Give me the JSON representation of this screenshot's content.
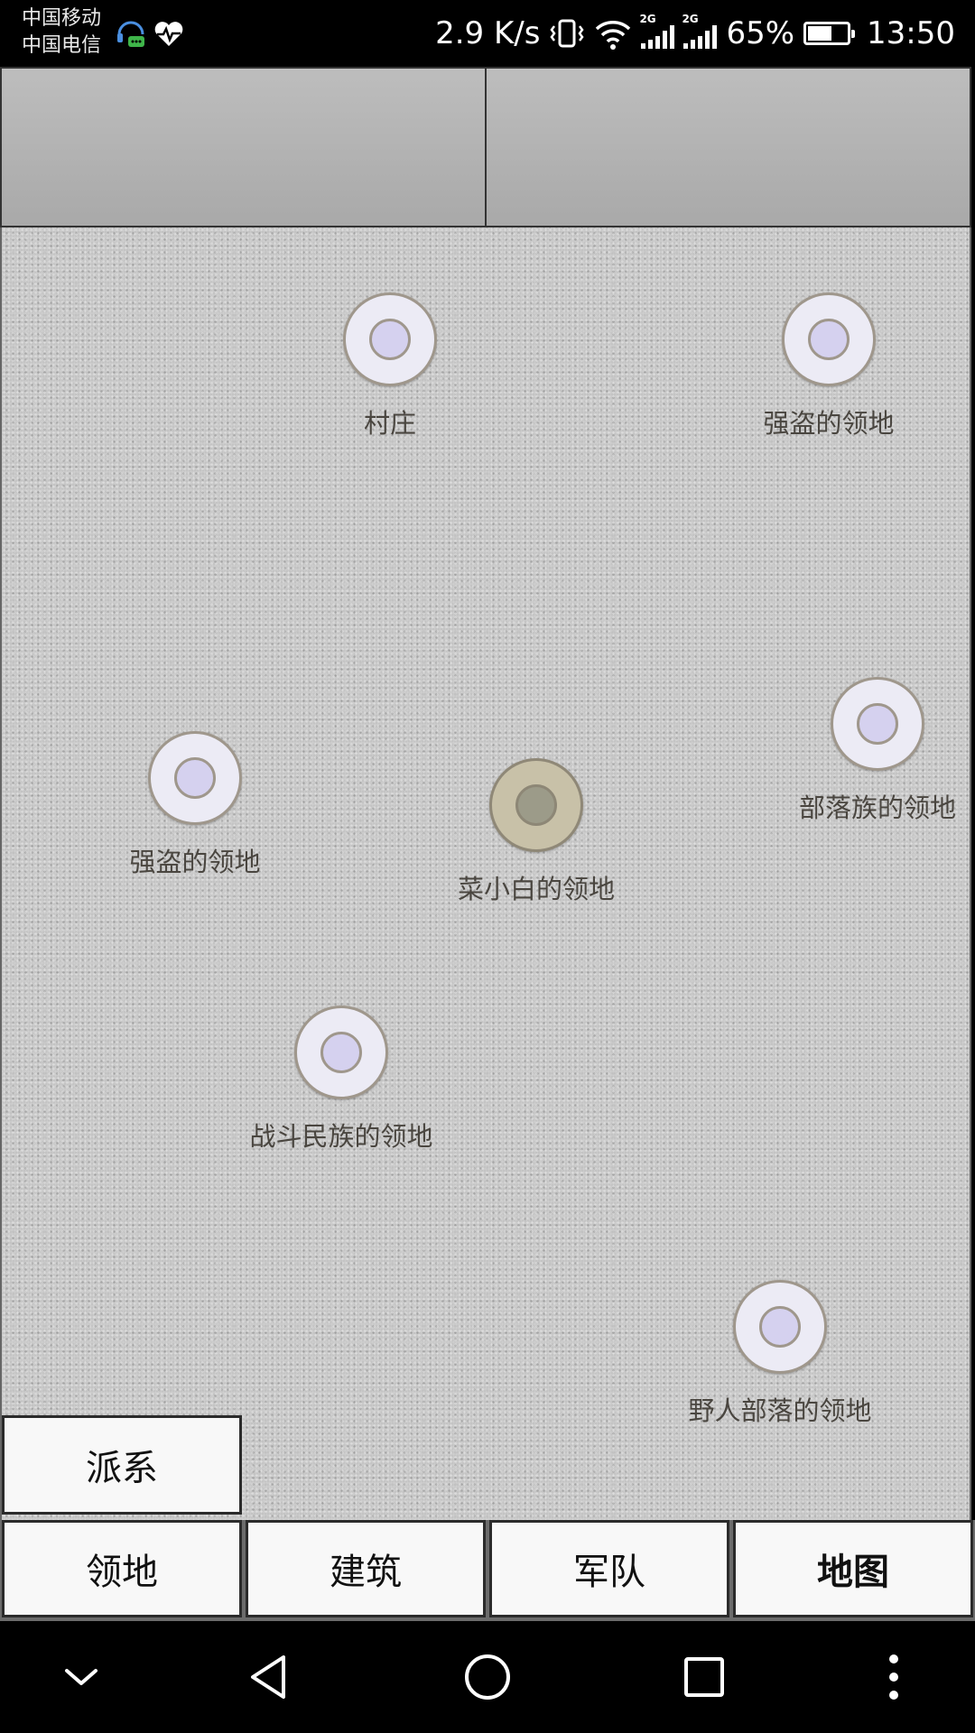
{
  "status_bar": {
    "carrier_1": "中国移动",
    "carrier_2": "中国电信",
    "net_speed": "2.9 K/s",
    "signal_1_tag": "2G",
    "signal_2_tag": "2G",
    "battery_percent": "65%",
    "battery_level": 0.65,
    "time": "13:50",
    "icons": [
      "headset-chat-icon",
      "heart-rate-icon",
      "vibrate-icon",
      "wifi-icon",
      "signal-icon",
      "battery-icon"
    ]
  },
  "map": {
    "nodes": [
      {
        "label": "村庄",
        "kind": "village"
      },
      {
        "label": "强盗的领地",
        "kind": "bandit"
      },
      {
        "label": "部落族的领地",
        "kind": "tribe"
      },
      {
        "label": "强盗的领地",
        "kind": "bandit"
      },
      {
        "label": "菜小白的领地",
        "kind": "self"
      },
      {
        "label": "战斗民族的领地",
        "kind": "warrior"
      },
      {
        "label": "野人部落的领地",
        "kind": "savage"
      }
    ]
  },
  "faction_button": {
    "label": "派系"
  },
  "tabs": [
    {
      "label": "领地",
      "active": false
    },
    {
      "label": "建筑",
      "active": false
    },
    {
      "label": "军队",
      "active": false
    },
    {
      "label": "地图",
      "active": true
    }
  ],
  "nav": [
    "chevron-down-icon",
    "back-icon",
    "home-icon",
    "recents-icon",
    "more-icon"
  ],
  "colors": {
    "map_bg": "#c2c2c2",
    "node_ring": "#9f978c",
    "node_fill": "#ecebf5",
    "node_inner": "#d5d1ef",
    "self_node_fill": "#c8c1a8",
    "self_node_inner": "#9c9b89"
  }
}
